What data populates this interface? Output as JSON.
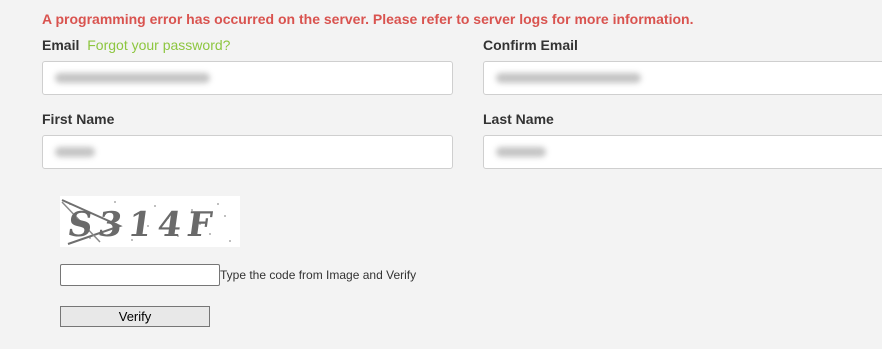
{
  "error_message": "A programming error has occurred on the server. Please refer to server logs for more information.",
  "form": {
    "email_label": "Email",
    "forgot_password_link": "Forgot your password?",
    "confirm_email_label": "Confirm Email",
    "first_name_label": "First Name",
    "last_name_label": "Last Name"
  },
  "captcha": {
    "image_text": "S314F",
    "hint": "Type the code from Image and Verify",
    "verify_label": "Verify"
  },
  "colors": {
    "error": "#d9534f",
    "link": "#8dc63f"
  }
}
